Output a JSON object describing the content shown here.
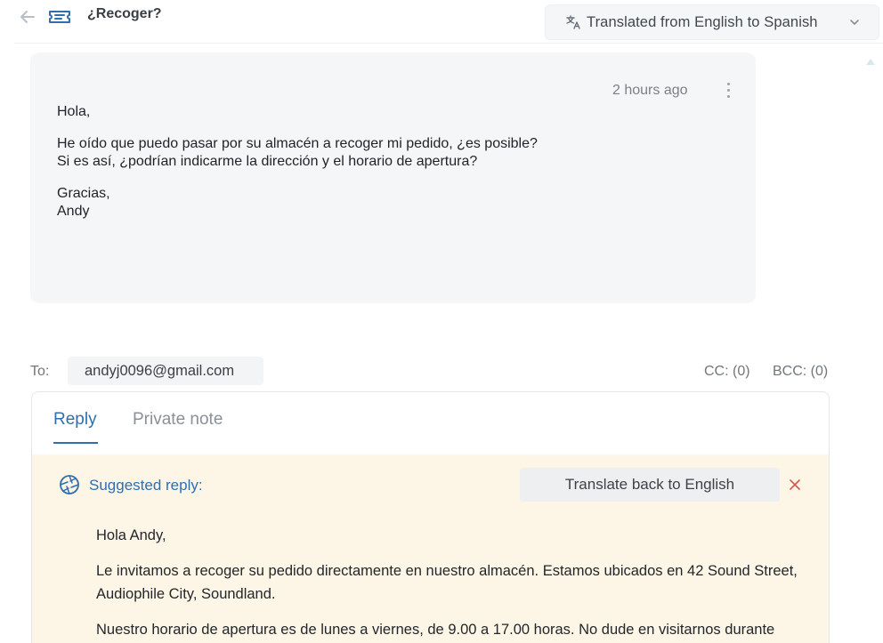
{
  "header": {
    "subject": "¿Recoger?",
    "translation_label": "Translated from English to Spanish"
  },
  "message": {
    "time": "2 hours ago",
    "lines": [
      "Hola,",
      "He oído que puedo pasar por su almacén a recoger mi pedido, ¿es posible?",
      "Si es así, ¿podrían indicarme la dirección y el horario de apertura?",
      "Gracias,",
      "Andy"
    ]
  },
  "recipients": {
    "to_label": "To:",
    "to_email": "andyj0096@gmail.com",
    "cc": "CC: (0)",
    "bcc": "BCC: (0)"
  },
  "editor": {
    "tabs": {
      "reply": "Reply",
      "private_note": "Private note"
    },
    "suggested_label": "Suggested reply:",
    "translate_back": "Translate back to English",
    "paragraphs": [
      "Hola Andy,",
      "Le invitamos a recoger su pedido directamente en nuestro almacén. Estamos ubicados en 42 Sound Street, Audiophile City, Soundland.",
      "Nuestro horario de apertura es de lunes a viernes, de 9.00 a 17.00 horas. No dude en visitarnos durante"
    ]
  },
  "colors": {
    "accent": "#2f6fb0",
    "suggest_bg": "#fdf5e6",
    "close_red": "#d9534f"
  }
}
